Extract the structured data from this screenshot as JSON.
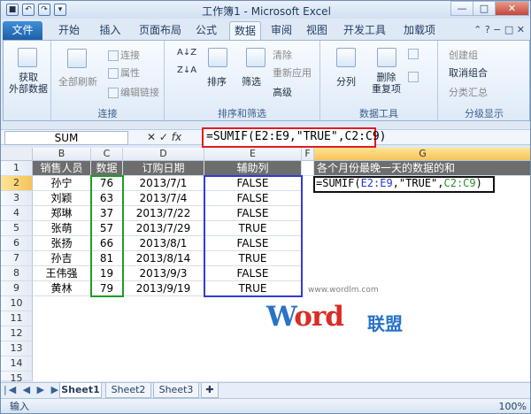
{
  "title": "工作簿1 - Microsoft Excel",
  "colors": {
    "file_tab": "#1d5fa7",
    "fx_highlight": "#e31b23",
    "green_range": "#1f9b2a",
    "blue_range": "#2f3bd6",
    "header_fill": "#6d6d6d"
  },
  "tabs": [
    "文件",
    "开始",
    "插入",
    "页面布局",
    "公式",
    "数据",
    "审阅",
    "视图",
    "开发工具",
    "加载项"
  ],
  "ribbon": {
    "get_external": "获取\n外部数据",
    "refresh_all": "全部刷新",
    "connections": "连接",
    "properties": "属性",
    "edit_links": "编辑链接",
    "connections_group": "连接",
    "sort_asc": "A↓Z",
    "sort_desc": "Z↓A",
    "sort": "排序",
    "filter": "筛选",
    "clear": "清除",
    "reapply": "重新应用",
    "advanced": "高级",
    "sort_filter_group": "排序和筛选",
    "text_to_columns": "分列",
    "remove_duplicates": "删除\n重复项",
    "data_tools_group": "数据工具",
    "group": "创建组",
    "ungroup": "取消组合",
    "subtotal": "分类汇总",
    "outline_group": "分级显示"
  },
  "formula_bar": {
    "name_box": "SUM",
    "formula": "=SUMIF(E2:E9,\"TRUE\",C2:C9)"
  },
  "columns": [
    "B",
    "C",
    "D",
    "E",
    "F",
    "G"
  ],
  "rows": [
    "1",
    "2",
    "3",
    "4",
    "5",
    "6",
    "7",
    "8",
    "9",
    "10",
    "11",
    "12",
    "13",
    "14",
    "15"
  ],
  "headers": {
    "B": "销售人员",
    "C": "数据",
    "D": "订购日期",
    "E": "辅助列",
    "G": "各个月份最晚一天的数据的和"
  },
  "data": [
    {
      "name": "孙宁",
      "value": "76",
      "date": "2013/7/1",
      "helper": "FALSE"
    },
    {
      "name": "刘颖",
      "value": "63",
      "date": "2013/7/4",
      "helper": "FALSE"
    },
    {
      "name": "郑琳",
      "value": "37",
      "date": "2013/7/22",
      "helper": "FALSE"
    },
    {
      "name": "张萌",
      "value": "57",
      "date": "2013/7/29",
      "helper": "TRUE"
    },
    {
      "name": "张扬",
      "value": "66",
      "date": "2013/8/1",
      "helper": "FALSE"
    },
    {
      "name": "孙吉",
      "value": "81",
      "date": "2013/8/14",
      "helper": "TRUE"
    },
    {
      "name": "王伟强",
      "value": "19",
      "date": "2013/9/3",
      "helper": "FALSE"
    },
    {
      "name": "黄林",
      "value": "79",
      "date": "2013/9/19",
      "helper": "TRUE"
    }
  ],
  "active_cell": {
    "prefix": "=SUMIF(",
    "range1": "E2:E9",
    "middle": ",\"TRUE\",",
    "range2": "C2:C9",
    "suffix": ")"
  },
  "sheets": [
    "Sheet1",
    "Sheet2",
    "Sheet3"
  ],
  "status": {
    "mode": "输入",
    "zoom": "100%"
  },
  "watermark": {
    "url": "www.wordlm.com",
    "word_part": "W",
    "word_rest": "ord",
    "union": "联盟"
  }
}
